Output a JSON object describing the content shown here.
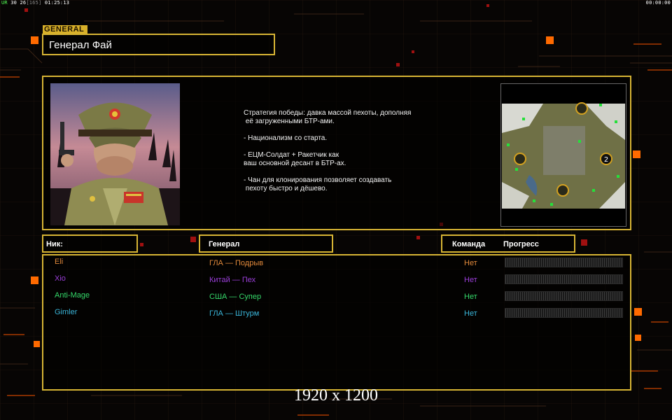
{
  "hud": {
    "left_prefix": "UR",
    "left_fps": "30 26",
    "left_bracket": "[165]",
    "left_time": "01:25:13",
    "right_time": "00:00:00"
  },
  "general_tag": "GENERAL",
  "title": "Генерал Фай",
  "description": "Стратегия победы: давка массой пехоты, дополняя\n её загруженными БТР-ами.\n\n- Национализм со старта.\n\n- ЕЦМ-Солдат + Ракетчик как\nваш основной десант в БТР-ах.\n\n- Чан для клонирования позволяет создавать\n пехоту быстро и дёшево.",
  "minimap": {
    "start_marker": "2"
  },
  "columns": {
    "nick": "Ник:",
    "general": "Генерал",
    "team": "Команда",
    "progress": "Прогресс"
  },
  "players": [
    {
      "nick": "Eli",
      "general": "ГЛА — Подрыв",
      "team": "Нет",
      "color": "#e0883a",
      "progress": 0
    },
    {
      "nick": "Xio",
      "general": "Китай — Пех",
      "team": "Нет",
      "color": "#9b3fd9",
      "progress": 0
    },
    {
      "nick": "Anti-Mage",
      "general": "США — Супер",
      "team": "Нет",
      "color": "#35d96a",
      "progress": 0
    },
    {
      "nick": "Gimler",
      "general": "ГЛА — Штурм",
      "team": "Нет",
      "color": "#3ab5d9",
      "progress": 0
    }
  ],
  "resolution_label": "1920 x 1200",
  "colors": {
    "accent": "#d7b434",
    "glow_orange": "#ff6a00"
  }
}
